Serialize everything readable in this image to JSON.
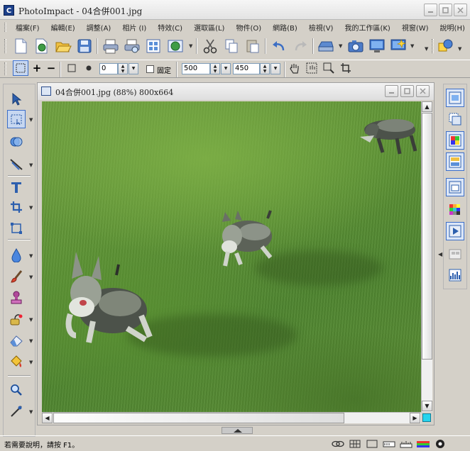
{
  "window": {
    "title": "PhotoImpact - 04合併001.jpg",
    "app_icon_text": "C"
  },
  "menu": [
    {
      "label": "檔案(F)"
    },
    {
      "label": "編輯(E)"
    },
    {
      "label": "調整(A)"
    },
    {
      "label": "相片 (I)"
    },
    {
      "label": "特效(C)"
    },
    {
      "label": "選取區(L)"
    },
    {
      "label": "物件(O)"
    },
    {
      "label": "網路(B)"
    },
    {
      "label": "檢視(V)"
    },
    {
      "label": "我的工作區(K)"
    },
    {
      "label": "視窗(W)"
    },
    {
      "label": "說明(H)"
    }
  ],
  "attributes": {
    "size_value": "0",
    "fixed_label": "固定",
    "fixed_checked": false,
    "width_value": "500",
    "height_value": "450"
  },
  "document": {
    "title": "04合併001.jpg (88%) 800x664",
    "image_description_alt": "photo"
  },
  "status": {
    "help_text": "若需要說明，請按 F1。"
  },
  "colors": {
    "accent": "#3c6ec8",
    "corner_swatch": "#26d4ee",
    "grass": "#5f9436"
  }
}
